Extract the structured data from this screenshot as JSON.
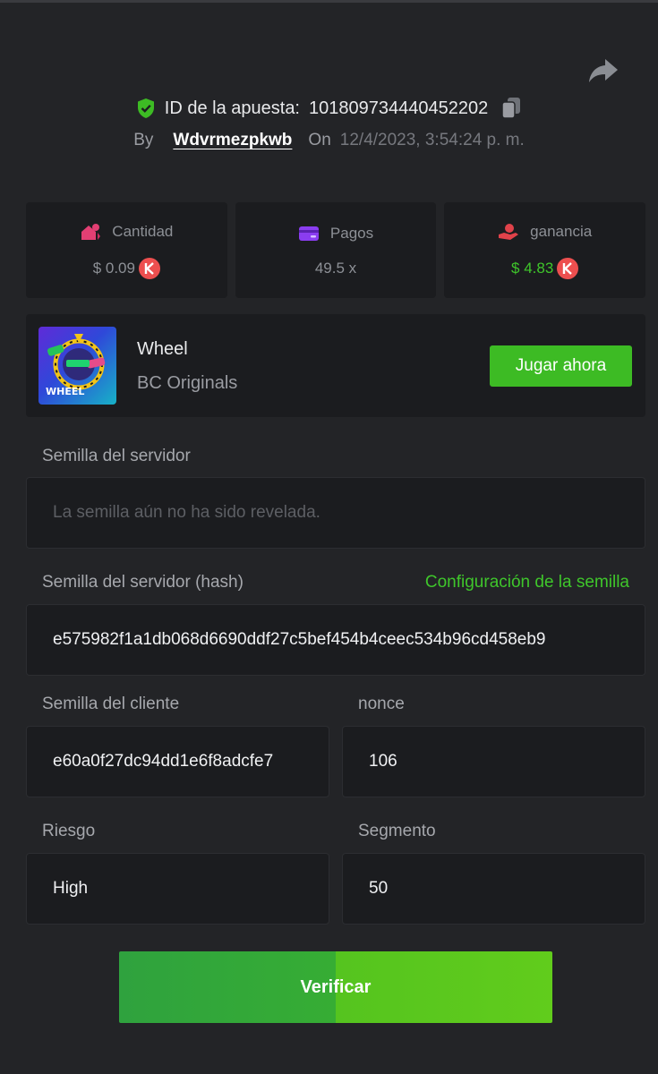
{
  "header": {
    "bet_id_label": "ID de la apuesta:",
    "bet_id": "101809734440452202",
    "by_label": "By",
    "username": "Wdvrmezpkwb",
    "on_label": "On",
    "date": "12/4/2023, 3:54:24 p. m."
  },
  "stats": [
    {
      "label": "Cantidad",
      "value": "$ 0.09",
      "icon": "amount-icon",
      "coin": "kcoin-icon"
    },
    {
      "label": "Pagos",
      "value": "49.5 x",
      "icon": "payout-card-icon"
    },
    {
      "label": "ganancia",
      "value": "$ 4.83",
      "icon": "profit-hand-icon",
      "coin": "kcoin-icon",
      "value_color": "#3fc62b"
    }
  ],
  "game": {
    "thumb_text": "WHEEL",
    "name": "Wheel",
    "provider": "BC Originals",
    "play_label": "Jugar ahora"
  },
  "server_seed": {
    "label": "Semilla del servidor",
    "placeholder": "La semilla aún no ha sido revelada."
  },
  "server_seed_hash": {
    "label": "Semilla del servidor (hash)",
    "config_link": "Configuración de la semilla",
    "value": "e575982f1a1db068d6690ddf27c5bef454b4ceec534b96cd458eb9"
  },
  "client_seed": {
    "label": "Semilla del cliente",
    "value": "e60a0f27dc94dd1e6f8adcfe7"
  },
  "nonce": {
    "label": "nonce",
    "value": "106"
  },
  "risk": {
    "label": "Riesgo",
    "value": "High"
  },
  "segment": {
    "label": "Segmento",
    "value": "50"
  },
  "verify_label": "Verificar",
  "colors": {
    "background": "#232427",
    "card": "#1b1c1f",
    "accent_green": "#3dbb24",
    "coin_red": "#ed4f4f"
  }
}
